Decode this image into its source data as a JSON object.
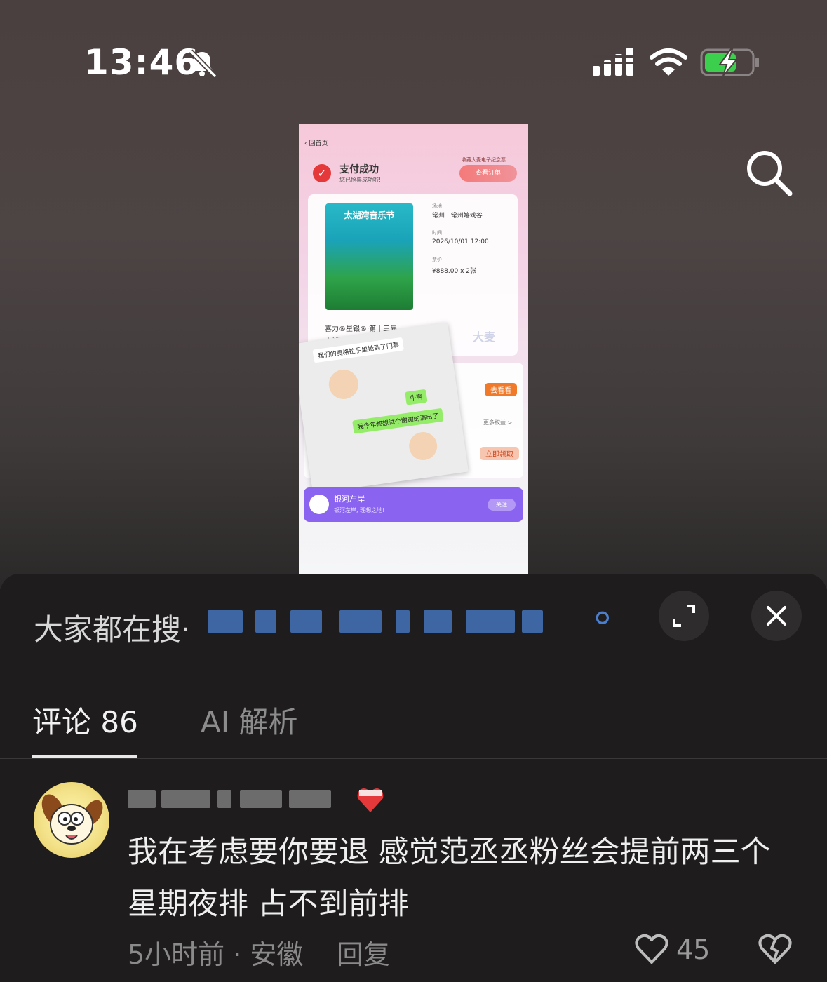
{
  "status_bar": {
    "time": "13:46"
  },
  "screenshot": {
    "back_label": "回首页",
    "pay_success": "支付成功",
    "pay_sub": "您已抢票成功啦!",
    "collect_badge": "收藏大麦电子纪念票",
    "view_order": "查看订单",
    "poster_title": "太湖湾音乐节",
    "venue_label": "场地",
    "venue_value": "常州 | 常州嬉戏谷",
    "time_label": "时间",
    "time_value": "2026/10/01 12:00",
    "price_label": "票价",
    "price_value": "¥888.00 x 2张",
    "event_name_1": "喜力®星银®·第十三届",
    "event_name_2": "太湖湾音乐节",
    "brand_watermark": "大麦",
    "chat_msg_1": "我们的奥格拉手里抢到了门票",
    "chat_msg_2": "牛啊",
    "chat_msg_3": "我今年都想试个谢谢的演出了",
    "go_watch": "去看看",
    "more_benefits": "更多权益 >",
    "claim_now": "立即领取",
    "account_name": "银河左岸",
    "account_slogan": "银河左岸, 理想之地!",
    "follow": "关注"
  },
  "sheet": {
    "hot_search_label": "大家都在搜·",
    "tabs": [
      {
        "label": "评论 86",
        "active": true
      },
      {
        "label": "AI 解析",
        "active": false
      }
    ]
  },
  "comment": {
    "text_line_1": "我在考虑要你要退 感觉范丞丞粉丝会提前两三个",
    "text_line_2": "星期夜排 占不到前排",
    "meta": "5小时前 · 安徽",
    "reply_label": "回复",
    "like_count": "45"
  },
  "icons": {
    "bell": "bell-slash-icon",
    "signal": "cell-signal-icon",
    "wifi": "wifi-icon",
    "battery": "battery-charging-icon",
    "search": "search-icon",
    "expand": "expand-icon",
    "close": "close-icon",
    "like": "heart-outline-icon",
    "dislike": "broken-heart-icon"
  },
  "colors": {
    "battery_green": "#3ccf4e",
    "accent_purple": "#8a63f0",
    "accent_orange": "#f07a2a",
    "badge_red": "#e5383b"
  }
}
